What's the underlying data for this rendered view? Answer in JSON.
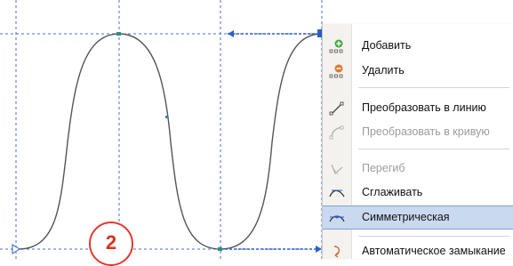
{
  "context_menu": {
    "items": [
      {
        "label": "Добавить",
        "icon": "add-node-icon",
        "disabled": false
      },
      {
        "label": "Удалить",
        "icon": "delete-node-icon",
        "disabled": false
      },
      {
        "label": "Преобразовать в линию",
        "icon": "to-line-icon",
        "disabled": false
      },
      {
        "label": "Преобразовать в кривую",
        "icon": "to-curve-icon",
        "disabled": true
      },
      {
        "label": "Перегиб",
        "icon": "cusp-icon",
        "disabled": true
      },
      {
        "label": "Сглаживать",
        "icon": "smooth-icon",
        "disabled": false
      },
      {
        "label": "Симметрическая",
        "icon": "symmetric-icon",
        "disabled": false,
        "highlighted": true
      },
      {
        "label": "Автоматическое замыкание",
        "icon": "auto-close-icon",
        "disabled": false
      }
    ]
  },
  "annotation": {
    "number": "2",
    "color": "#e03a2c"
  },
  "colors": {
    "guide": "#4a6fd1",
    "curve": "#555555",
    "highlight": "#c8d9f0"
  }
}
